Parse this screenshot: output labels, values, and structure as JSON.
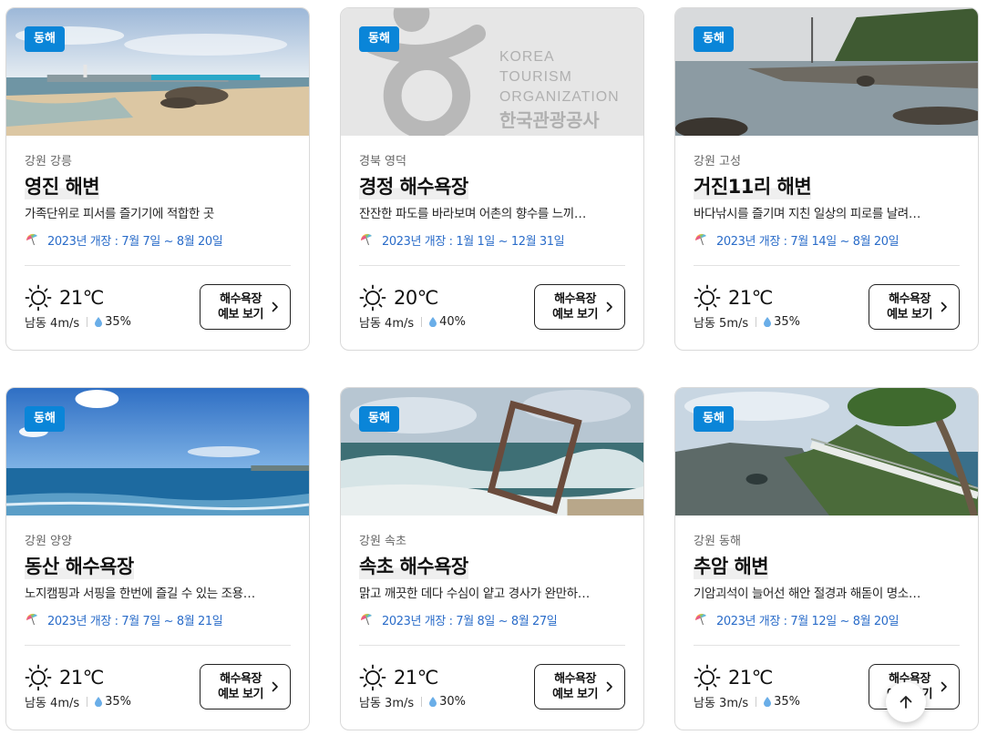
{
  "cards": [
    {
      "badge": "동해",
      "region": "강원 강릉",
      "title": "영진 해변",
      "desc": "가족단위로 피서를 즐기기에 적합한 곳",
      "open": "2023년 개장 : 7월 7일 ~ 8월 20일",
      "temp": "21℃",
      "wind": "남동 4m/s",
      "humidity": "35%",
      "btn_line1": "해수욕장",
      "btn_line2": "예보 보기",
      "image": "beach-breakwater"
    },
    {
      "badge": "동해",
      "region": "경북 영덕",
      "title": "경정 해수욕장",
      "desc": "잔잔한 파도를 바라보며 어촌의 향수를 느끼…",
      "open": "2023년 개장 : 1월 1일 ~ 12월 31일",
      "temp": "20℃",
      "wind": "남동 4m/s",
      "humidity": "40%",
      "btn_line1": "해수욕장",
      "btn_line2": "예보 보기",
      "image": "kto-placeholder",
      "logo_en": [
        "KOREA",
        "TOURISM",
        "ORGANIZATION"
      ],
      "logo_ko": "한국관광공사"
    },
    {
      "badge": "동해",
      "region": "강원 고성",
      "title": "거진11리 해변",
      "desc": "바다낚시를 즐기며 지친 일상의 피로를 날려…",
      "open": "2023년 개장 : 7월 14일 ~ 8월 20일",
      "temp": "21℃",
      "wind": "남동 5m/s",
      "humidity": "35%",
      "btn_line1": "해수욕장",
      "btn_line2": "예보 보기",
      "image": "rocky-coast"
    },
    {
      "badge": "동해",
      "region": "강원 양양",
      "title": "동산 해수욕장",
      "desc": "노지캠핑과 서핑을 한번에 즐길 수 있는 조용…",
      "open": "2023년 개장 : 7월 7일 ~ 8월 21일",
      "temp": "21℃",
      "wind": "남동 4m/s",
      "humidity": "35%",
      "btn_line1": "해수욕장",
      "btn_line2": "예보 보기",
      "image": "blue-sea"
    },
    {
      "badge": "동해",
      "region": "강원 속초",
      "title": "속초 해수욕장",
      "desc": "맑고 깨끗한 데다 수심이 얕고 경사가 완만하…",
      "open": "2023년 개장 : 7월 8일 ~ 8월 27일",
      "temp": "21℃",
      "wind": "남동 3m/s",
      "humidity": "30%",
      "btn_line1": "해수욕장",
      "btn_line2": "예보 보기",
      "image": "waves-frame"
    },
    {
      "badge": "동해",
      "region": "강원 동해",
      "title": "추암 해변",
      "desc": "기암괴석이 늘어선 해안 절경과 해돋이 명소…",
      "open": "2023년 개장 : 7월 12일 ~ 8월 20일",
      "temp": "21℃",
      "wind": "남동 3m/s",
      "humidity": "35%",
      "btn_line1": "해수욕장",
      "btn_line2": "예보 보기",
      "image": "cliff-walkway"
    }
  ],
  "colors": {
    "badge": "#0a85d8",
    "open_text": "#2a6cc9",
    "drop": "#6aaee8"
  },
  "icons": {
    "weather": "sun-icon",
    "humidity": "drop-icon",
    "open": "umbrella-icon",
    "scroll_top": "arrow-up-icon",
    "button": "chevron-right-icon"
  }
}
